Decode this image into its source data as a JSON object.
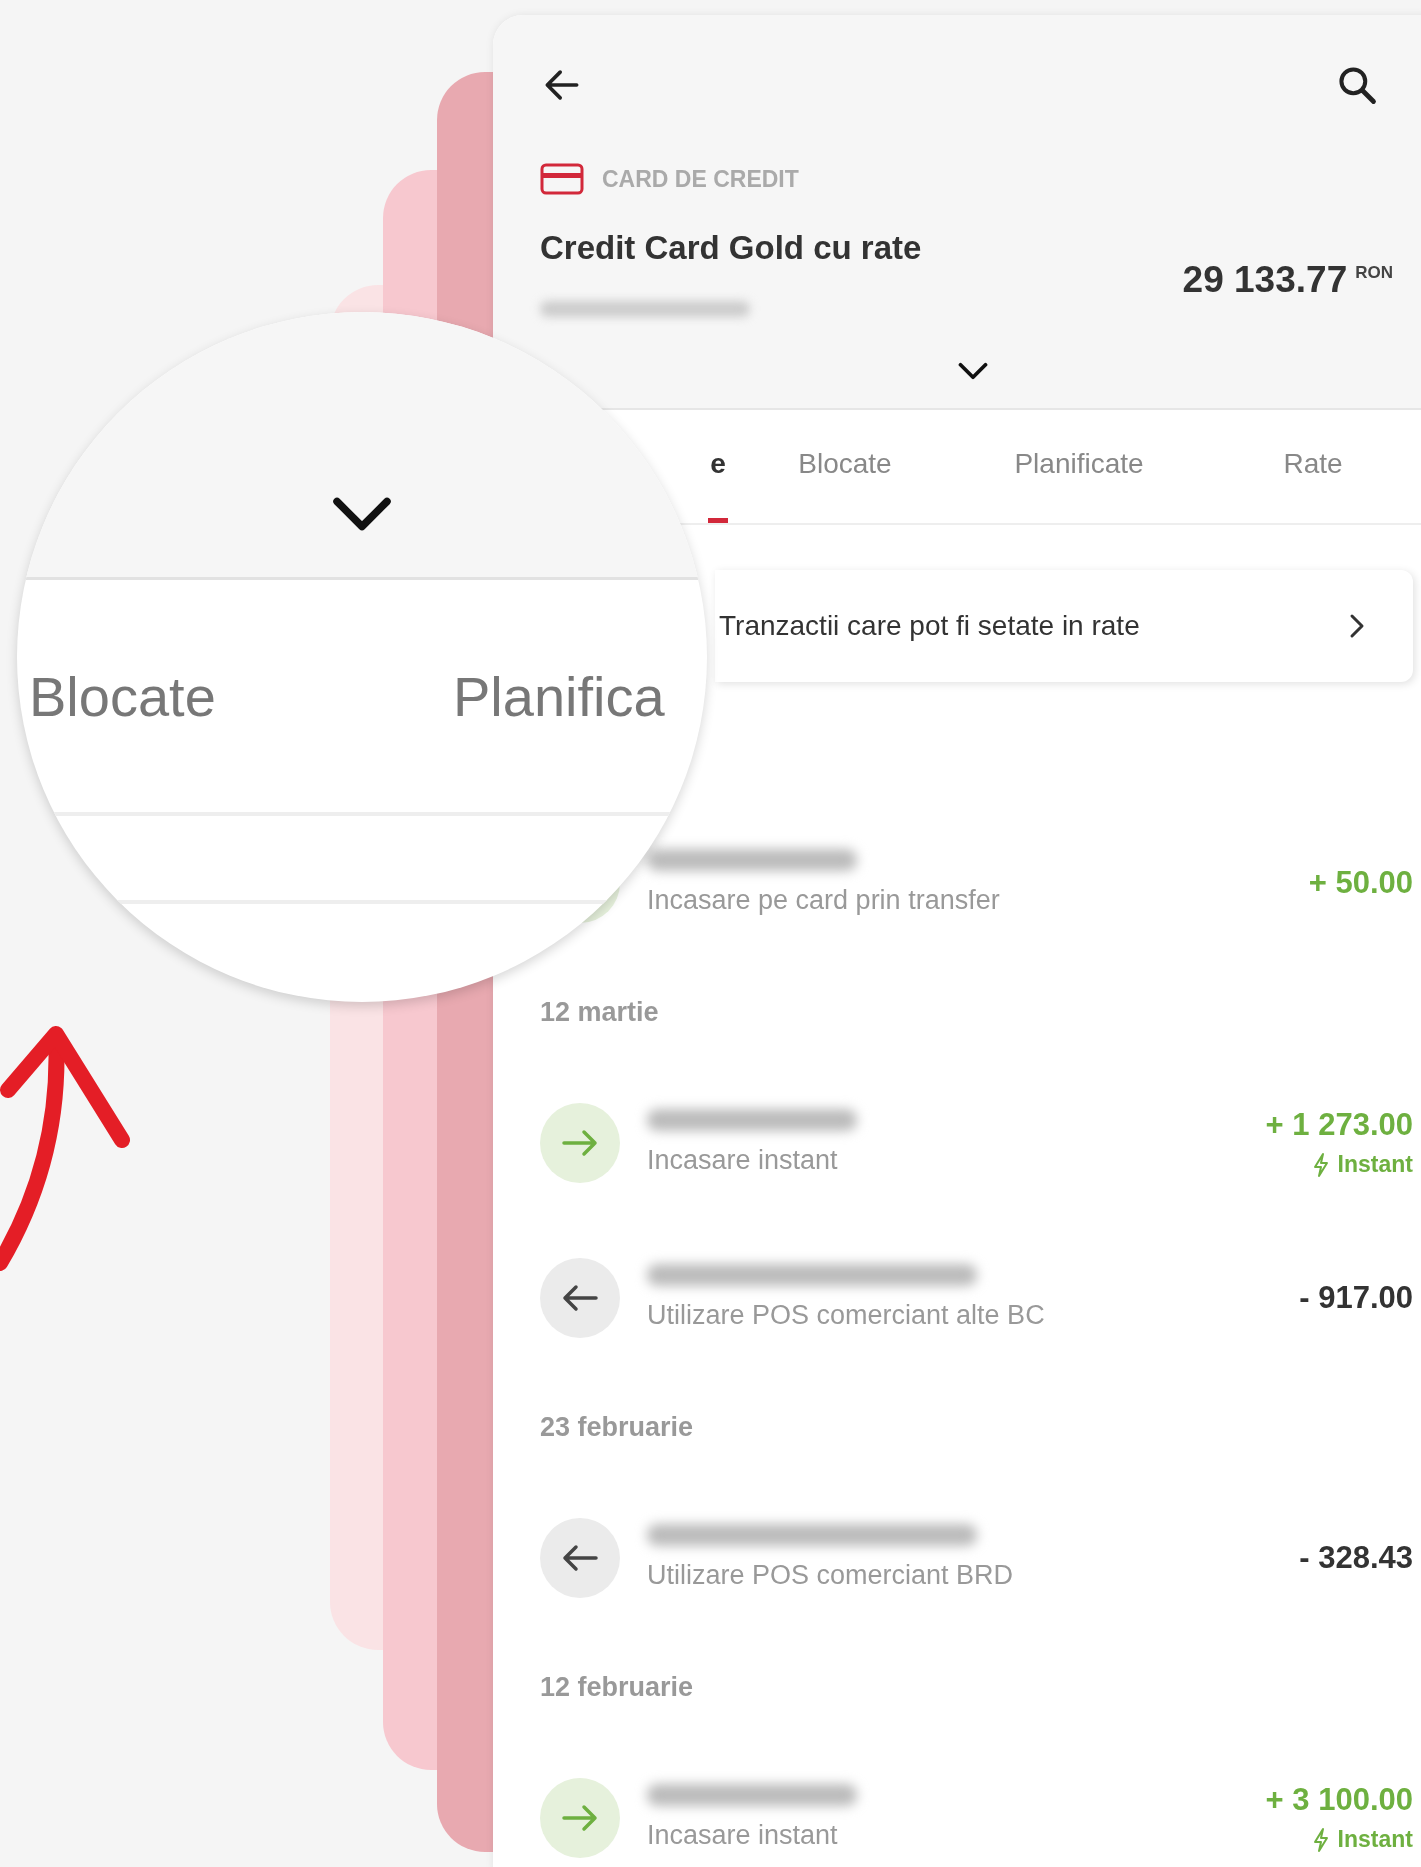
{
  "header": {
    "category": "CARD DE CREDIT",
    "title": "Credit Card Gold cu rate",
    "balance": "29 133.77",
    "currency": "RON"
  },
  "tabs": [
    {
      "label": "e",
      "selected": true
    },
    {
      "label": "Blocate",
      "selected": false
    },
    {
      "label": "Planificate",
      "selected": false
    },
    {
      "label": "Rate",
      "selected": false
    }
  ],
  "banner": {
    "text": "Tranzactii care pot fi setate in rate"
  },
  "entries": [
    {
      "kind": "incoming",
      "description": "Incasare pe card prin transfer",
      "amount": "+ 50.00"
    },
    {
      "kind": "date",
      "label": "12 martie"
    },
    {
      "kind": "incoming",
      "description": "Incasare instant",
      "amount": "+ 1 273.00",
      "badge": "Instant"
    },
    {
      "kind": "outgoing",
      "description": "Utilizare POS comerciant alte BC",
      "amount": "- 917.00"
    },
    {
      "kind": "date",
      "label": "23 februarie"
    },
    {
      "kind": "outgoing",
      "description": "Utilizare POS comerciant BRD",
      "amount": "- 328.43"
    },
    {
      "kind": "date",
      "label": "12 februarie"
    },
    {
      "kind": "incoming",
      "description": "Incasare instant",
      "amount": "+ 3 100.00",
      "badge": "Instant"
    }
  ],
  "magnifier": {
    "labels": [
      "Blocate",
      "Planifica"
    ]
  }
}
